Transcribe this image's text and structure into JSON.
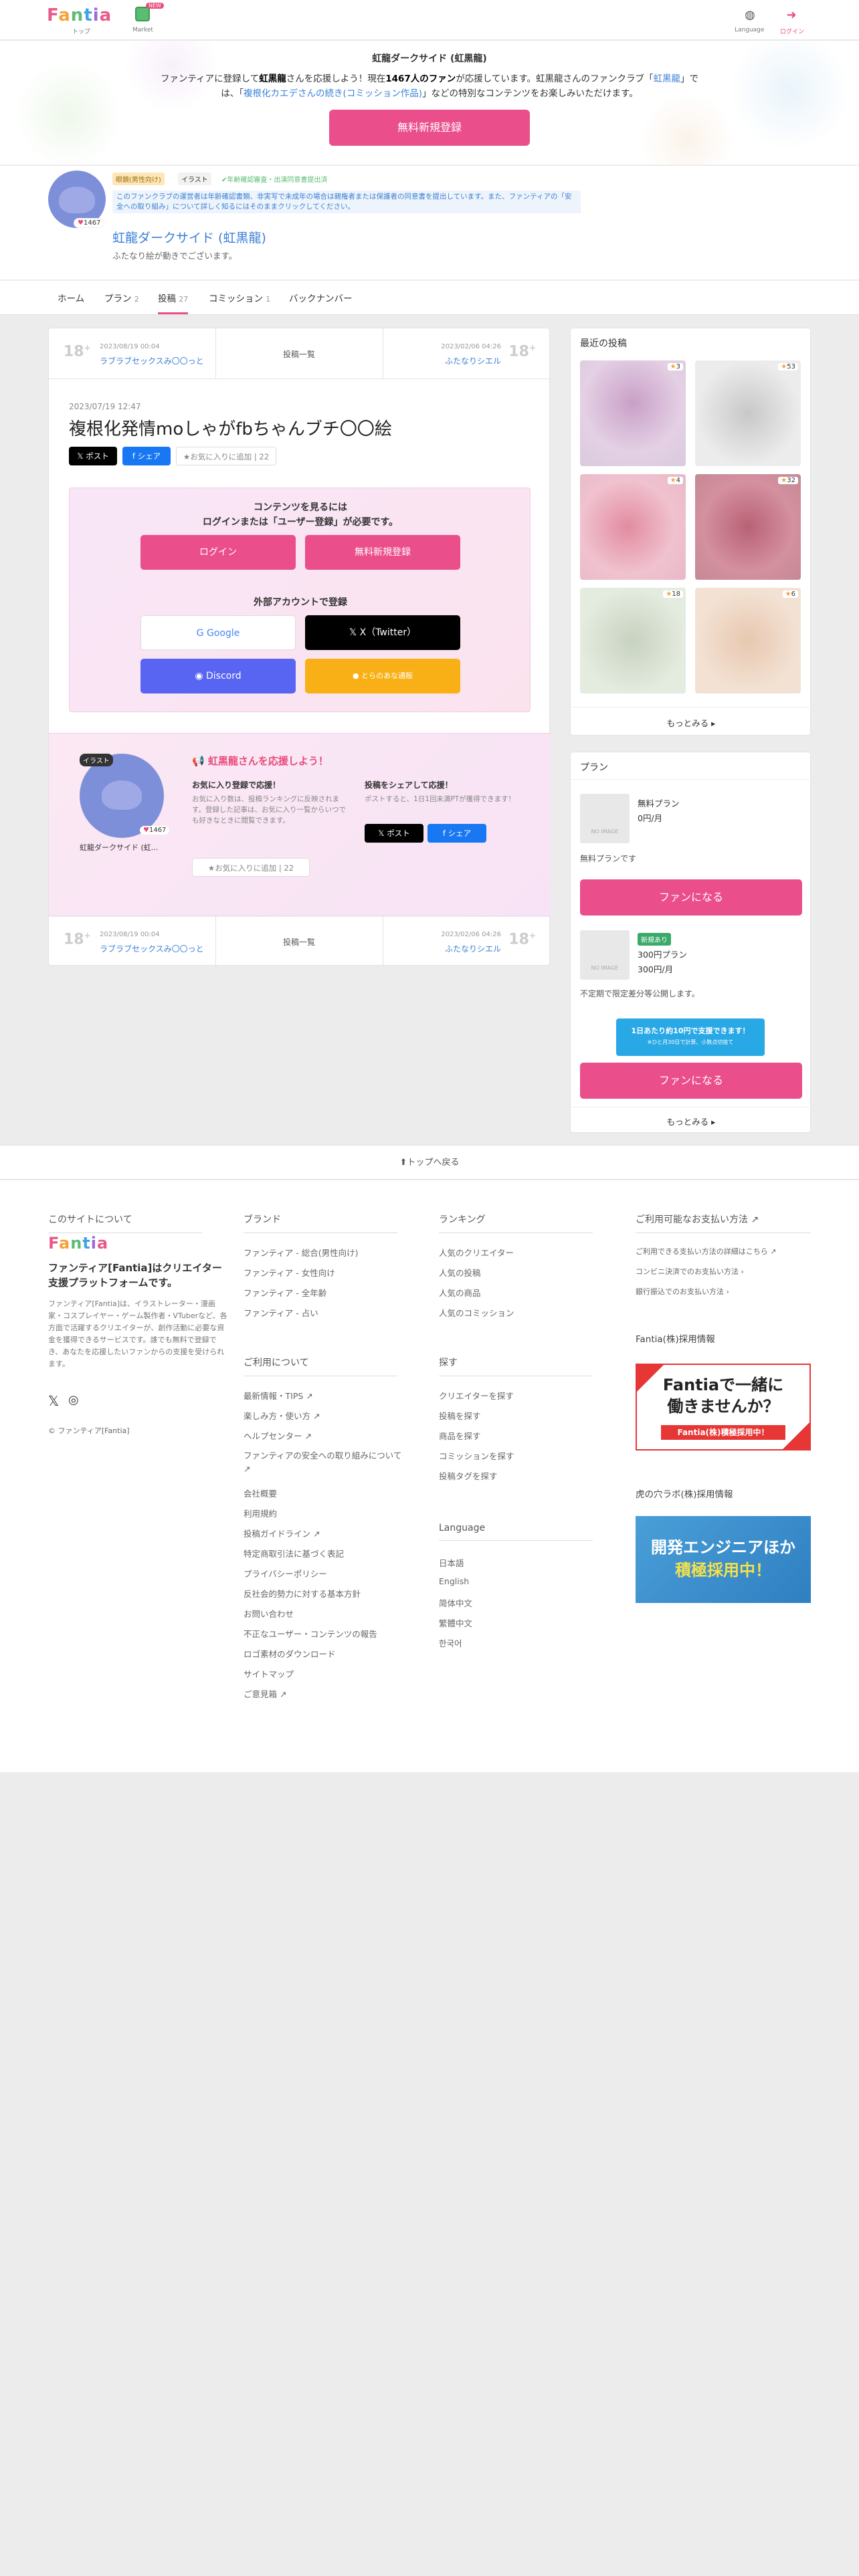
{
  "header": {
    "logo": "Fantia",
    "top_label": "トップ",
    "market_label": "Market",
    "market_badge": "NEW",
    "language_label": "Language",
    "login_label": "ログイン"
  },
  "banner": {
    "title": "虹龍ダークサイド (虹黒龍)",
    "line1_pre": "ファンティアに登録して",
    "line1_name": "虹黒龍",
    "line1_mid": "さんを応援しよう！現在",
    "line1_count": "1467人のファン",
    "line1_post": "が応援しています。虹黒龍さんのファンクラブ「",
    "line1_club": "虹黒龍",
    "line1_end": "」で",
    "line2_pre": "は、「",
    "line2_link": "複根化カエデさんの続き(コミッション作品)",
    "line2_post": "」などの特別なコンテンツをお楽しみいただけます。",
    "register_btn": "無料新規登録"
  },
  "profile": {
    "fans": "1467",
    "tag_adult": "眼鏡(男性向け)",
    "tag_illust": "イラスト",
    "tag_verified": "年齢確認審査・出演同意書提出済",
    "notice": "このファンクラブの運営者は年齢確認書類、非実写で未成年の場合は親権者または保護者の同意書を提出しています。また、ファンティアの「安全への取り組み」について詳しく知るにはそのままクリックしてください。",
    "name": "虹龍ダークサイド (虹黒龍)",
    "desc": "ふたなり絵が動きでございます。"
  },
  "tabs": [
    {
      "label": "ホーム",
      "count": ""
    },
    {
      "label": "プラン",
      "count": "2"
    },
    {
      "label": "投稿",
      "count": "27"
    },
    {
      "label": "コミッション",
      "count": "1"
    },
    {
      "label": "バックナンバー",
      "count": ""
    }
  ],
  "post": {
    "prev": {
      "date": "2023/08/19 00:04",
      "title": "ラブラブセックスみ〇〇っと"
    },
    "list_label": "投稿一覧",
    "next": {
      "date": "2023/02/06 04:26",
      "title": "ふたなりシエル"
    },
    "date": "2023/07/19 12:47",
    "title": "複根化発情moしゃがfbちゃんブチ〇〇絵",
    "share_x": "ポスト",
    "share_fb": "シェア",
    "fav": "★お気に入りに追加",
    "fav_count": "22"
  },
  "gate": {
    "line1": "コンテンツを見るには",
    "line2": "ログインまたは「ユーザー登録」が必要です。",
    "login": "ログイン",
    "register": "無料新規登録",
    "external": "外部アカウントで登録",
    "google": "Google",
    "twitter": "X（Twitter）",
    "discord": "Discord",
    "other": "とらのあな通販"
  },
  "support": {
    "badge": "イラスト",
    "fans": "1467",
    "name": "虹龍ダークサイド (虹...",
    "title": "虹黒龍さんを応援しよう！",
    "fav_title": "お気に入り登録で応援！",
    "fav_desc": "お気に入り数は、投稿ランキングに反映されます。登録した記事は、お気に入り一覧からいつでも好きなときに閲覧できます。",
    "fav_btn": "★お気に入りに追加",
    "fav_count": "22",
    "share_title": "投稿をシェアして応援！",
    "share_desc": "ポストすると、1日1回未満PTが獲得できます！",
    "share_x": "ポスト",
    "share_fb": "シェア"
  },
  "recent": {
    "title": "最近の投稿",
    "stars": [
      "3",
      "53",
      "4",
      "32",
      "18",
      "6"
    ],
    "more": "もっとみる"
  },
  "plans": {
    "title": "プラン",
    "free_name": "無料プラン",
    "free_price": "0円/月",
    "free_desc": "無料プランです",
    "fan_btn": "ファンになる",
    "p_badge": "新規あり",
    "p_name": "300円プラン",
    "p_price": "300円/月",
    "p_desc": "不定期で限定差分等公開します。",
    "promo1": "1日あたり約10円で支援できます！",
    "promo2": "※ひと月30日で計算、小数点切捨て",
    "fan_btn2": "ファンになる",
    "more": "もっとみる",
    "no_image": "NO IMAGE"
  },
  "totop": "トップへ戻る",
  "footer": {
    "about_h": "このサイトについて",
    "about_big": "ファンティア[Fantia]はクリエイター支援プラットフォームです。",
    "about_small": "ファンティア[Fantia]は、イラストレーター・漫画家・コスプレイヤー・ゲーム製作者・VTuberなど、各方面で活躍するクリエイターが、創作活動に必要な資金を獲得できるサービスです。誰でも無料で登録でき、あなたを応援したいファンからの支援を受けられます。",
    "copyright": "© ファンティア[Fantia]",
    "brand_h": "ブランド",
    "brand": [
      "ファンティア - 総合(男性向け)",
      "ファンティア - 女性向け",
      "ファンティア - 全年齢",
      "ファンティア - 占い"
    ],
    "rank_h": "ランキング",
    "rank": [
      "人気のクリエイター",
      "人気の投稿",
      "人気の商品",
      "人気のコミッション"
    ],
    "pay_h": "ご利用可能なお支払い方法",
    "pay": [
      "ご利用できる支払い方法の詳細はこちら",
      "コンビニ決済でのお支払い方法",
      "銀行振込でのお支払い方法"
    ],
    "use_h": "ご利用について",
    "use": [
      "最新情報・TIPS",
      "楽しみ方・使い方",
      "ヘルプセンター",
      "ファンティアの安全への取り組みについて",
      "会社概要",
      "利用規約",
      "投稿ガイドライン",
      "特定商取引法に基づく表記",
      "プライバシーポリシー",
      "反社会的勢力に対する基本方針",
      "お問い合わせ",
      "不正なユーザー・コンテンツの報告",
      "ロゴ素材のダウンロード",
      "サイトマップ",
      "ご意見箱"
    ],
    "search_h": "探す",
    "search": [
      "クリエイターを探す",
      "投稿を探す",
      "商品を探す",
      "コミッションを探す",
      "投稿タグを探す"
    ],
    "lang_h": "Language",
    "langs": [
      "日本語",
      "English",
      "简体中文",
      "繁體中文",
      "한국어"
    ],
    "recruit1_h": "Fantia(株)採用情報",
    "recruit1_a": "Fantiaで一緒に",
    "recruit1_b": "働きませんか？",
    "recruit1_c": "Fantia(株)積極採用中！",
    "recruit2_h": "虎の穴ラボ(株)採用情報",
    "recruit2_a": "開発エンジニアほか",
    "recruit2_b": "積極採用中！"
  },
  "colors": {
    "accent": "#ea4e8b",
    "link": "#3a7fd6"
  }
}
